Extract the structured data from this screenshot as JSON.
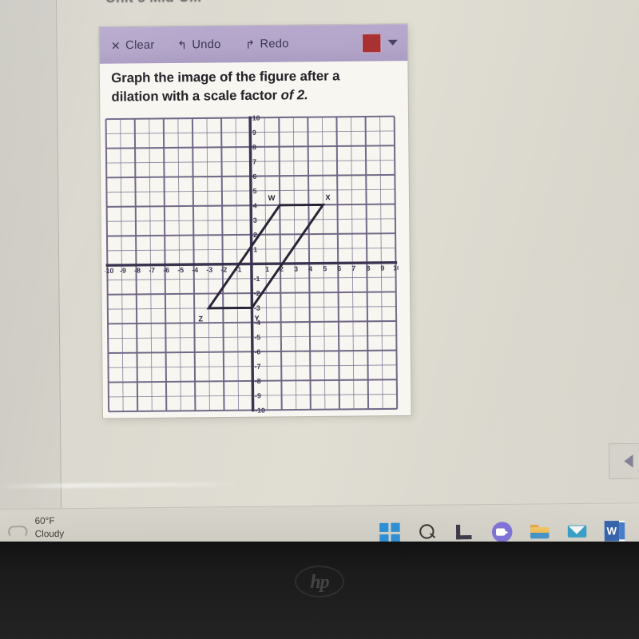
{
  "page": {
    "cut_heading": "Unit 5 Mid-U..."
  },
  "toolbar": {
    "clear_label": "Clear",
    "clear_icon": "close-x-icon",
    "undo_label": "Undo",
    "undo_icon": "undo-arrow-icon",
    "redo_label": "Redo",
    "redo_icon": "redo-arrow-icon",
    "color_swatch_hex": "#a83232",
    "caret_icon": "chevron-down-icon",
    "background_hex": "#b3a5c9",
    "text_hex": "#3a3550"
  },
  "prompt": {
    "line1": "Graph the image of the figure after a",
    "line2_a": "dilation with a scale factor ",
    "line2_em": "of 2."
  },
  "chart_data": {
    "type": "scatter",
    "title": "",
    "xlabel": "",
    "ylabel": "",
    "xlim": [
      -10,
      10
    ],
    "ylim": [
      -10,
      10
    ],
    "grid": true,
    "minor_grid_step": 1,
    "major_grid_step": 2,
    "x_ticks": [
      -10,
      -9,
      -8,
      -7,
      -6,
      -5,
      -4,
      -3,
      -2,
      -1,
      1,
      2,
      3,
      4,
      5,
      6,
      7,
      8,
      9,
      10
    ],
    "y_ticks": [
      -10,
      -9,
      -8,
      -7,
      -6,
      -5,
      -4,
      -3,
      -2,
      -1,
      1,
      2,
      3,
      4,
      5,
      6,
      7,
      8,
      9,
      10
    ],
    "x_tick_labels": [
      "-10",
      "-9",
      "-8",
      "-7",
      "-6",
      "-5",
      "-4",
      "-3",
      "-2",
      "-1",
      "1",
      "2",
      "3",
      "4",
      "5",
      "6",
      "7",
      "8",
      "9",
      "10"
    ],
    "y_tick_labels": [
      "-10",
      "-9",
      "-8",
      "-7",
      "-6",
      "-5",
      "-4",
      "-3",
      "-2",
      "-1",
      "1",
      "2",
      "3",
      "4",
      "5",
      "6",
      "7",
      "8",
      "9",
      "10"
    ],
    "axis_color": "#3c3350",
    "grid_color": "#6e6385",
    "figure_color": "#2b2438",
    "series": [
      {
        "name": "parallelogram WXYZ",
        "closed": true,
        "points": [
          {
            "label": "W",
            "x": 2,
            "y": 4,
            "label_dx": -10,
            "label_dy": -6
          },
          {
            "label": "X",
            "x": 5,
            "y": 4,
            "label_dx": 6,
            "label_dy": -6
          },
          {
            "label": "Y",
            "x": 0,
            "y": -3,
            "label_dx": 6,
            "label_dy": 16
          },
          {
            "label": "Z",
            "x": -3,
            "y": -3,
            "label_dx": -10,
            "label_dy": 16
          }
        ]
      }
    ]
  },
  "side_panel": {
    "collapse_icon": "chevron-left-icon"
  },
  "taskbar": {
    "weather": {
      "icon": "cloud-icon",
      "temperature": "60°F",
      "condition": "Cloudy"
    },
    "icons": [
      {
        "name": "start-icon",
        "label": "Start"
      },
      {
        "name": "search-icon",
        "label": "Search"
      },
      {
        "name": "task-view-icon",
        "label": "Task View"
      },
      {
        "name": "teams-icon",
        "label": "Chat"
      },
      {
        "name": "file-explorer-icon",
        "label": "File Explorer"
      },
      {
        "name": "mail-icon",
        "label": "Mail"
      },
      {
        "name": "word-icon",
        "label": "Word"
      }
    ]
  },
  "device": {
    "brand": "hp"
  }
}
